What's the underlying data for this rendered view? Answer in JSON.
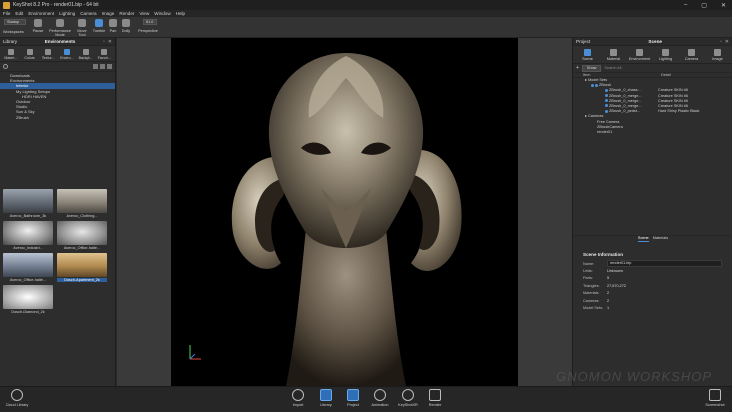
{
  "window": {
    "title": "KeyShot 8.2 Pro - render01.bip - 64 bit"
  },
  "menu": [
    "File",
    "Edit",
    "Environment",
    "Lighting",
    "Camera",
    "Image",
    "Render",
    "View",
    "Window",
    "Help"
  ],
  "toolbar": {
    "startup": "Startup",
    "workspaces": "Workspaces",
    "pause": "Pause",
    "performance_mode": "Performance Mode",
    "move_tool": "Move Tool",
    "tumble": "Tumble",
    "pan": "Pan",
    "dolly": "Dolly",
    "perspective": "Perspective",
    "fov": "61.0"
  },
  "library": {
    "panel_title": "Library",
    "section_title": "Environments",
    "tabs": [
      "Materi...",
      "Colors",
      "Textur...",
      "Enviro...",
      "Backpl...",
      "Favori..."
    ],
    "tree": [
      "Downloads",
      "Environments",
      "Interior",
      "My Lighting Setups",
      "HDRI HAVEN",
      "Outdoor",
      "Studio",
      "Sun & Sky",
      "ZBrush"
    ],
    "thumbnails": [
      {
        "label": "Averoc_Bathroom_3k"
      },
      {
        "label": "Averoc_Clothing..."
      },
      {
        "label": "Averoc_Industri..."
      },
      {
        "label": "Averoc_Office-halte..."
      },
      {
        "label": "Averoc_Office-halte..."
      },
      {
        "label": "Dosch-Apartment_2k"
      },
      {
        "label": "Dosch-Diamond_2k"
      }
    ],
    "bottom_label": "Cloud Library"
  },
  "project": {
    "panel_title": "Project",
    "section_title": "Scene",
    "tabs": [
      "Scene",
      "Material",
      "Environment",
      "Lighting",
      "Camera",
      "Image"
    ],
    "show_button": "Show",
    "search_placeholder": "Search All",
    "col_item": "Item",
    "col_detail": "Detail",
    "rows": [
      {
        "name": "Model Sets",
        "detail": ""
      },
      {
        "name": "ZBrush",
        "detail": ""
      },
      {
        "name": "ZBrush_0_chass...",
        "detail": "Creature SKIN #6"
      },
      {
        "name": "ZBrush_0_merge...",
        "detail": "Creature SKIN #6"
      },
      {
        "name": "ZBrush_0_merge...",
        "detail": "Creature SKIN #6"
      },
      {
        "name": "ZBrush_0_merge...",
        "detail": "Creature SKIN #6"
      },
      {
        "name": "ZBrush_0_pedst...",
        "detail": "Hard Shiny Plastic Black"
      },
      {
        "name": "Cameras",
        "detail": ""
      },
      {
        "name": "Free Camera",
        "detail": ""
      },
      {
        "name": "ZBrushCamera",
        "detail": ""
      },
      {
        "name": "render01",
        "detail": ""
      }
    ],
    "subtabs": [
      "Scene",
      "Materials"
    ],
    "info": {
      "header": "Scene Information",
      "name_label": "Name:",
      "name_value": "render01.bip",
      "units_label": "Units:",
      "units_value": "Unknown",
      "parts_label": "Parts:",
      "parts_value": "5",
      "triangles_label": "Triangles:",
      "triangles_value": "27,670,272",
      "materials_label": "Materials:",
      "materials_value": "2",
      "cameras_label": "Cameras:",
      "cameras_value": "2",
      "modelsets_label": "Model Sets:",
      "modelsets_value": "1"
    }
  },
  "bottom": {
    "cloud_library": "Cloud Library",
    "import": "Import",
    "library": "Library",
    "project": "Project",
    "animation": "Animation",
    "keyshotxr": "KeyShotXR",
    "render": "Render",
    "screenshot": "Screenshot"
  },
  "watermark": "GNOMON WORKSHOP",
  "colors": {
    "accent": "#2f6fb8",
    "selection": "#2f5f9a"
  }
}
